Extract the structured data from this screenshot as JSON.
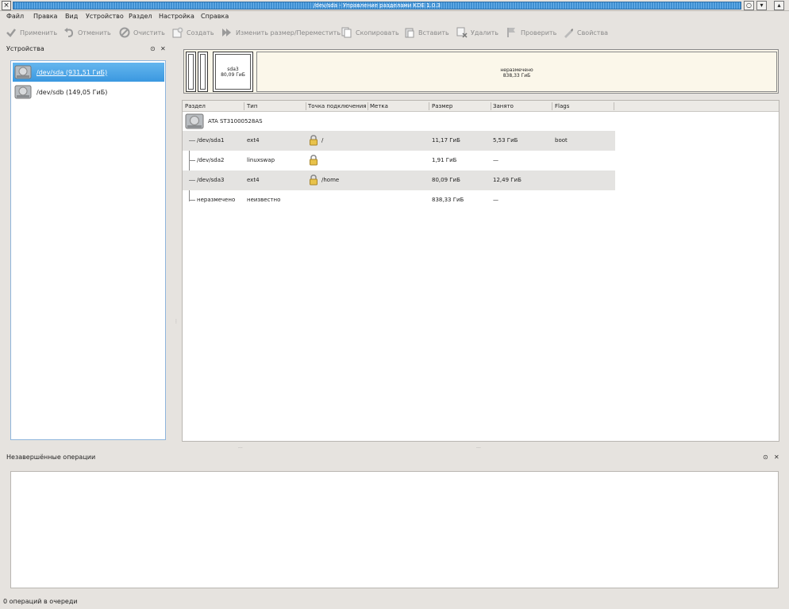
{
  "window": {
    "title": "/dev/sda - Управление разделами KDE 1.0.3",
    "close_glyph": "×",
    "btn_glyphs": [
      "○",
      "▾",
      "▴"
    ]
  },
  "menu": [
    {
      "label": "Файл"
    },
    {
      "label": "Правка"
    },
    {
      "label": "Вид"
    },
    {
      "label": "Устройство"
    },
    {
      "label": "Раздел"
    },
    {
      "label": "Настройка"
    },
    {
      "label": "Справка"
    }
  ],
  "toolbar": [
    {
      "label": "Применить",
      "icon": "check-icon"
    },
    {
      "label": "Отменить",
      "icon": "undo-icon"
    },
    {
      "label": "Очистить",
      "icon": "clear-icon"
    },
    {
      "label": "Создать",
      "icon": "new-icon"
    },
    {
      "label": "Изменить размер/Переместить",
      "icon": "resize-icon"
    },
    {
      "label": "Скопировать",
      "icon": "copy-icon"
    },
    {
      "label": "Вставить",
      "icon": "paste-icon"
    },
    {
      "label": "Удалить",
      "icon": "delete-icon"
    },
    {
      "label": "Проверить",
      "icon": "flag-icon"
    },
    {
      "label": "Свойства",
      "icon": "properties-icon"
    }
  ],
  "devices": {
    "title": "Устройства",
    "dock_float": "⊙",
    "dock_close": "✕",
    "items": [
      {
        "label": "/dev/sda (931,51 ГиБ)",
        "selected": true
      },
      {
        "label": "/dev/sdb (149,05 ГиБ)",
        "selected": false
      }
    ]
  },
  "map": {
    "sda3_name": "sda3",
    "sda3_size": "80,09 ГиБ",
    "unalloc_name": "неразмечено",
    "unalloc_size": "838,33 ГиБ"
  },
  "table": {
    "headers": [
      "Раздел",
      "Тип",
      "Точка подключения",
      "Метка",
      "Размер",
      "Занято",
      "Flags"
    ],
    "disk_label": "ATA ST31000528AS",
    "rows": [
      {
        "partition": "/dev/sda1",
        "type": "ext4",
        "locked": true,
        "mount": "/",
        "label": "",
        "size": "11,17 ГиБ",
        "used": "5,53 ГиБ",
        "flags": "boot"
      },
      {
        "partition": "/dev/sda2",
        "type": "linuxswap",
        "locked": true,
        "mount": "",
        "label": "",
        "size": "1,91 ГиБ",
        "used": "—",
        "flags": ""
      },
      {
        "partition": "/dev/sda3",
        "type": "ext4",
        "locked": true,
        "mount": "/home",
        "label": "",
        "size": "80,09 ГиБ",
        "used": "12,49 ГиБ",
        "flags": ""
      },
      {
        "partition": "неразмечено",
        "type": "неизвестно",
        "locked": false,
        "mount": "",
        "label": "",
        "size": "838,33 ГиБ",
        "used": "—",
        "flags": ""
      }
    ]
  },
  "pending": {
    "title": "Незавершённые операции",
    "dock_float": "⊙",
    "dock_close": "✕"
  },
  "status": {
    "text": "0 операций в очереди"
  }
}
